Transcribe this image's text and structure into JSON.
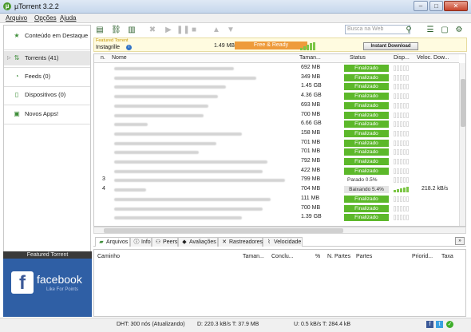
{
  "window": {
    "title": "µTorrent 3.2.2",
    "app_icon": "utorrent-logo-icon"
  },
  "menu": [
    "Arquivo",
    "Opções",
    "Ajuda"
  ],
  "sidebar": {
    "items": [
      {
        "label": "Conteúdo em Destaque",
        "icon": "star-icon"
      },
      {
        "label": "Torrents (41)",
        "icon": "torrents-icon"
      },
      {
        "label": "Feeds (0)",
        "icon": "rss-icon"
      },
      {
        "label": "Dispositivos (0)",
        "icon": "device-icon"
      },
      {
        "label": "Novos Apps!",
        "icon": "apps-icon"
      }
    ],
    "featured": {
      "header": "Featured Torrent",
      "brand": "facebook",
      "sub": "Like For Points"
    }
  },
  "toolbar": {
    "search_placeholder": "Busca na Web"
  },
  "ad": {
    "featured": "Featured Torrent",
    "name": "Instagrille",
    "size": "1.49 MB",
    "status": "Free & Ready",
    "button": "Instant Download"
  },
  "list": {
    "headers": [
      "n.",
      "Nome",
      "Taman...",
      "Status",
      "Disp...",
      "Veloc. Dow..."
    ],
    "rows": [
      {
        "n": "",
        "size": "692 MB",
        "status": "Finalizado",
        "speed": ""
      },
      {
        "n": "",
        "size": "349 MB",
        "status": "Finalizado",
        "speed": ""
      },
      {
        "n": "",
        "size": "1.45 GB",
        "status": "Finalizado",
        "speed": ""
      },
      {
        "n": "",
        "size": "4.36 GB",
        "status": "Finalizado",
        "speed": ""
      },
      {
        "n": "",
        "size": "693 MB",
        "status": "Finalizado",
        "speed": ""
      },
      {
        "n": "",
        "size": "700 MB",
        "status": "Finalizado",
        "speed": ""
      },
      {
        "n": "",
        "size": "6.66 GB",
        "status": "Finalizado",
        "speed": ""
      },
      {
        "n": "",
        "size": "158 MB",
        "status": "Finalizado",
        "speed": ""
      },
      {
        "n": "",
        "size": "701 MB",
        "status": "Finalizado",
        "speed": ""
      },
      {
        "n": "",
        "size": "701 MB",
        "status": "Finalizado",
        "speed": ""
      },
      {
        "n": "",
        "size": "792 MB",
        "status": "Finalizado",
        "speed": ""
      },
      {
        "n": "",
        "size": "422 MB",
        "status": "Finalizado",
        "speed": ""
      },
      {
        "n": "3",
        "size": "799 MB",
        "status": "Parado 0.5%",
        "speed": ""
      },
      {
        "n": "4",
        "size": "704 MB",
        "status": "Baixando 5.4%",
        "speed": "218.2 kB/s"
      },
      {
        "n": "",
        "size": "111 MB",
        "status": "Finalizado",
        "speed": ""
      },
      {
        "n": "",
        "size": "700 MB",
        "status": "Finalizado",
        "speed": ""
      },
      {
        "n": "",
        "size": "1.39 GB",
        "status": "Finalizado",
        "speed": ""
      }
    ]
  },
  "tabs": [
    "Arquivos",
    "Info",
    "Peers",
    "Avaliações",
    "Rastreadores",
    "Velocidade"
  ],
  "files_headers": [
    "Caminho",
    "Taman...",
    "Conclu...",
    "%",
    "N. Partes",
    "Partes",
    "Priorid...",
    "Taxa"
  ],
  "status": {
    "dht": "DHT: 300 nós  (Atualizando)",
    "down": "D: 220.3 kB/s T: 37.9 MB",
    "up": "U: 0.5 kB/s T: 284.4 kB"
  },
  "colors": {
    "finished": "#5cb82a",
    "accent": "#3f8e3a",
    "free_ready": "#ee9b3b"
  }
}
